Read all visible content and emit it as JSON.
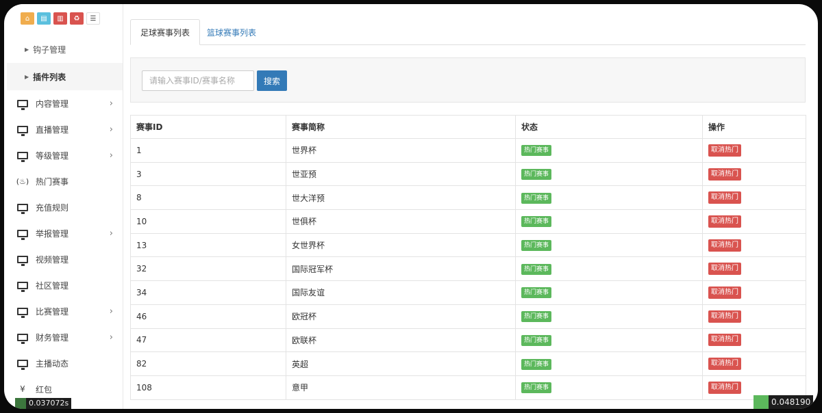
{
  "sidebar": {
    "sub_items": [
      {
        "label": "钩子管理",
        "active": false
      },
      {
        "label": "插件列表",
        "active": true
      }
    ],
    "items": [
      {
        "label": "内容管理",
        "icon": "monitor-icon",
        "has_children": true
      },
      {
        "label": "直播管理",
        "icon": "monitor-icon",
        "has_children": true
      },
      {
        "label": "等级管理",
        "icon": "monitor-icon",
        "has_children": true
      },
      {
        "label": "热门赛事",
        "icon": "fire-icon",
        "has_children": false
      },
      {
        "label": "充值规则",
        "icon": "monitor-icon",
        "has_children": false
      },
      {
        "label": "举报管理",
        "icon": "monitor-icon",
        "has_children": true
      },
      {
        "label": "视频管理",
        "icon": "monitor-icon",
        "has_children": false
      },
      {
        "label": "社区管理",
        "icon": "monitor-icon",
        "has_children": false
      },
      {
        "label": "比赛管理",
        "icon": "monitor-icon",
        "has_children": true
      },
      {
        "label": "财务管理",
        "icon": "monitor-icon",
        "has_children": true
      },
      {
        "label": "主播动态",
        "icon": "monitor-icon",
        "has_children": false
      },
      {
        "label": "红包",
        "icon": "yen-icon",
        "has_children": false
      }
    ]
  },
  "tabs": [
    {
      "label": "足球赛事列表",
      "active": true
    },
    {
      "label": "篮球赛事列表",
      "active": false
    }
  ],
  "search": {
    "placeholder": "请输入赛事ID/赛事名称",
    "button_label": "搜索"
  },
  "table": {
    "headers": [
      "赛事ID",
      "赛事简称",
      "状态",
      "操作"
    ],
    "rows": [
      {
        "id": "1",
        "name": "世界杯",
        "status": "热门赛事",
        "action": "取消热门"
      },
      {
        "id": "3",
        "name": "世亚预",
        "status": "热门赛事",
        "action": "取消热门"
      },
      {
        "id": "8",
        "name": "世大洋预",
        "status": "热门赛事",
        "action": "取消热门"
      },
      {
        "id": "10",
        "name": "世俱杯",
        "status": "热门赛事",
        "action": "取消热门"
      },
      {
        "id": "13",
        "name": "女世界杯",
        "status": "热门赛事",
        "action": "取消热门"
      },
      {
        "id": "32",
        "name": "国际冠军杯",
        "status": "热门赛事",
        "action": "取消热门"
      },
      {
        "id": "34",
        "name": "国际友谊",
        "status": "热门赛事",
        "action": "取消热门"
      },
      {
        "id": "46",
        "name": "欧冠杯",
        "status": "热门赛事",
        "action": "取消热门"
      },
      {
        "id": "47",
        "name": "欧联杯",
        "status": "热门赛事",
        "action": "取消热门"
      },
      {
        "id": "82",
        "name": "英超",
        "status": "热门赛事",
        "action": "取消热门"
      },
      {
        "id": "108",
        "name": "意甲",
        "status": "热门赛事",
        "action": "取消热门"
      }
    ]
  },
  "debug": {
    "left_time": "0.037072s",
    "right_time": "0.048190"
  },
  "colors": {
    "primary": "#337ab7",
    "success": "#5cb85c",
    "danger": "#d9534f",
    "warning": "#f0ad4e"
  }
}
